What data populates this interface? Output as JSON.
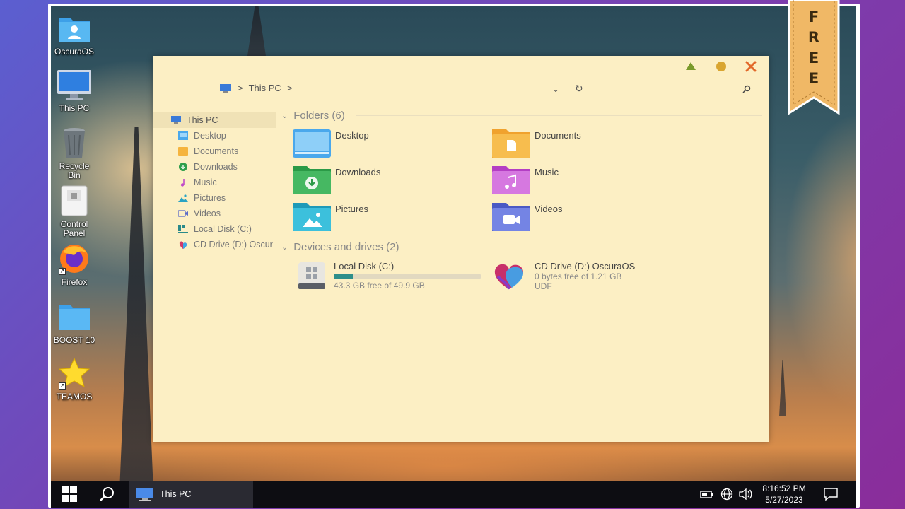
{
  "desktop_icons": [
    {
      "label": "OscuraOS"
    },
    {
      "label": "This PC"
    },
    {
      "label": "Recycle Bin"
    },
    {
      "label": "Control Panel"
    },
    {
      "label": "Firefox"
    },
    {
      "label": "BOOST 10"
    },
    {
      "label": "TEAMOS"
    }
  ],
  "ribbon": {
    "letters": [
      "F",
      "R",
      "E",
      "E"
    ]
  },
  "window": {
    "address": {
      "location": "This PC",
      "separator": ">"
    },
    "nav": {
      "root": "This PC",
      "items": [
        "Desktop",
        "Documents",
        "Downloads",
        "Music",
        "Pictures",
        "Videos",
        "Local Disk (C:)",
        "CD Drive (D:) Oscur"
      ]
    },
    "folders_header": "Folders (6)",
    "folders": [
      "Desktop",
      "Documents",
      "Downloads",
      "Music",
      "Pictures",
      "Videos"
    ],
    "drives_header": "Devices and drives (2)",
    "drives": [
      {
        "name": "Local Disk (C:)",
        "free": "43.3 GB free of 49.9 GB",
        "used_fraction": 0.13
      },
      {
        "name": "CD Drive (D:) OscuraOS",
        "free": "0 bytes free of 1.21 GB",
        "fs": "UDF"
      }
    ]
  },
  "taskbar": {
    "app_label": "This PC",
    "time": "8:16:52 PM",
    "date": "5/27/2023"
  },
  "colors": {
    "window_bg": "#fcefc4",
    "accent_teal": "#2f8f8a",
    "ribbon": "#f0b866",
    "taskbar": "#0d0d12"
  }
}
